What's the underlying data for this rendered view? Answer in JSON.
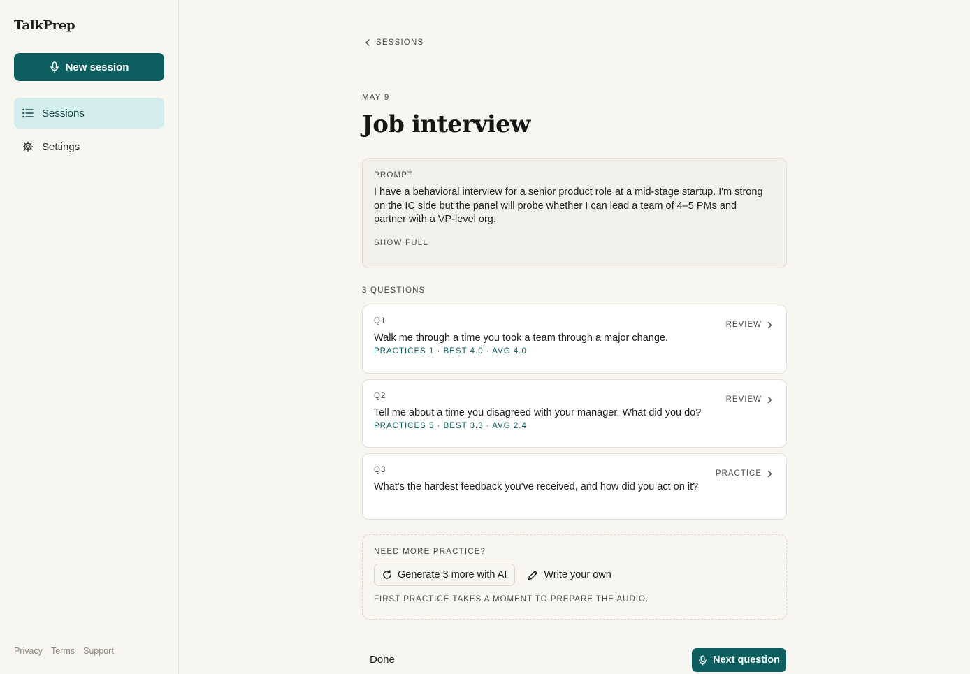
{
  "app": {
    "name": "TalkPrep"
  },
  "sidebar": {
    "new_session_label": "New session",
    "items": [
      {
        "label": "Sessions",
        "icon": "list-icon",
        "active": true
      },
      {
        "label": "Settings",
        "icon": "gear-icon",
        "active": false
      }
    ],
    "footer_links": [
      "Privacy",
      "Terms",
      "Support"
    ]
  },
  "main": {
    "back_label": "SESSIONS",
    "date": "MAY 9",
    "title": "Job interview",
    "prompt": {
      "label": "PROMPT",
      "text": "I have a behavioral interview for a senior product role at a mid-stage startup. I'm strong on the IC side but the panel will probe whether I can lead a team of 4–5 PMs and partner with a VP-level org.",
      "show_full_label": "SHOW FULL"
    },
    "questions_count_label": "3 QUESTIONS",
    "questions": [
      {
        "number": "Q1",
        "text": "Walk me through a time you took a team through a major change.",
        "stats": "PRACTICES 1 · BEST 4.0 · AVG 4.0",
        "action": "REVIEW"
      },
      {
        "number": "Q2",
        "text": "Tell me about a time you disagreed with your manager. What did you do?",
        "stats": "PRACTICES 5 · BEST 3.3 · AVG 2.4",
        "action": "REVIEW"
      },
      {
        "number": "Q3",
        "text": "What's the hardest feedback you've received, and how did you act on it?",
        "stats": "",
        "action": "PRACTICE"
      }
    ],
    "more_practice": {
      "label": "NEED MORE PRACTICE?",
      "generate_label": "Generate 3 more with AI",
      "write_label": "Write your own",
      "hint": "FIRST PRACTICE TAKES A MOMENT TO PREPARE THE AUDIO."
    },
    "done_label": "Done",
    "next_label": "Next question"
  },
  "colors": {
    "accent": "#0d5f5f",
    "active_nav_bg": "#d3ecec",
    "page_bg": "#f8f6f1"
  }
}
